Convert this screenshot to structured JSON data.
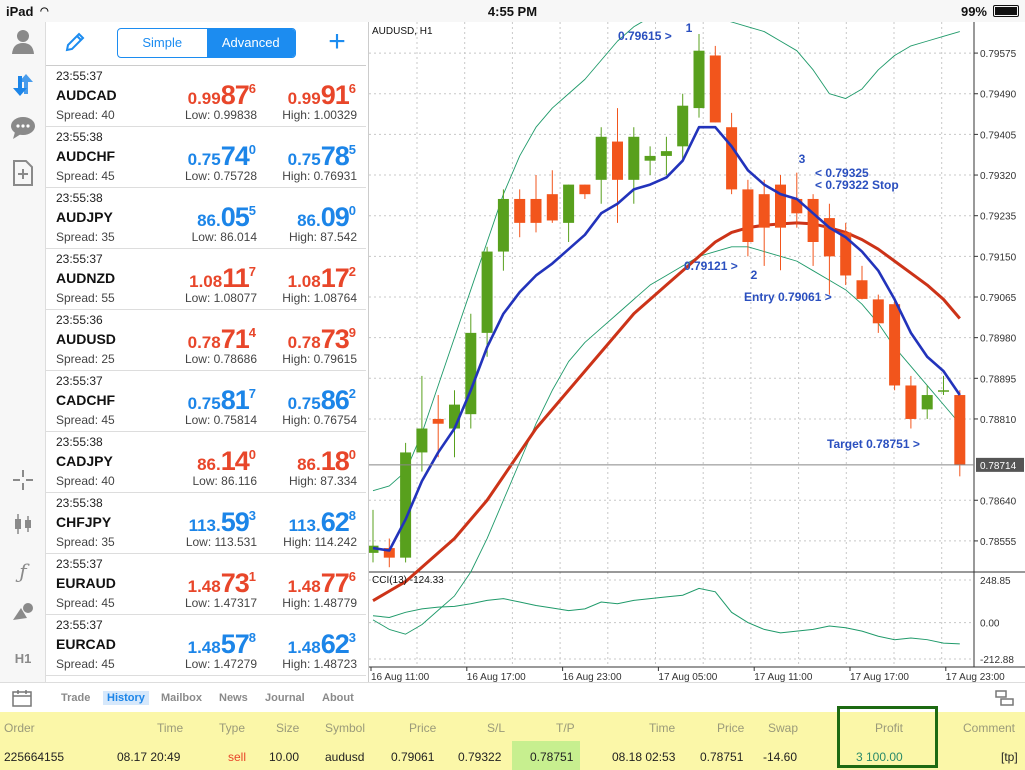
{
  "status": {
    "device": "iPad",
    "time": "4:55 PM",
    "battery": "99%"
  },
  "toolbar": {
    "simple_label": "Simple",
    "advanced_label": "Advanced"
  },
  "quotes": [
    {
      "time": "23:55:37",
      "symbol": "AUDCAD",
      "spread": "Spread: 40",
      "low": "Low: 0.99838",
      "high": "High: 1.00329",
      "bid": {
        "pre": "0.99",
        "big": "87",
        "sup": "6"
      },
      "ask": {
        "pre": "0.99",
        "big": "91",
        "sup": "6"
      },
      "color": "red"
    },
    {
      "time": "23:55:38",
      "symbol": "AUDCHF",
      "spread": "Spread: 45",
      "low": "Low: 0.75728",
      "high": "High: 0.76931",
      "bid": {
        "pre": "0.75",
        "big": "74",
        "sup": "0"
      },
      "ask": {
        "pre": "0.75",
        "big": "78",
        "sup": "5"
      },
      "color": "blue"
    },
    {
      "time": "23:55:38",
      "symbol": "AUDJPY",
      "spread": "Spread: 35",
      "low": "Low: 86.014",
      "high": "High: 87.542",
      "bid": {
        "pre": "86.",
        "big": "05",
        "sup": "5"
      },
      "ask": {
        "pre": "86.",
        "big": "09",
        "sup": "0"
      },
      "color": "blue"
    },
    {
      "time": "23:55:37",
      "symbol": "AUDNZD",
      "spread": "Spread: 55",
      "low": "Low: 1.08077",
      "high": "High: 1.08764",
      "bid": {
        "pre": "1.08",
        "big": "11",
        "sup": "7"
      },
      "ask": {
        "pre": "1.08",
        "big": "17",
        "sup": "2"
      },
      "color": "red"
    },
    {
      "time": "23:55:36",
      "symbol": "AUDUSD",
      "spread": "Spread: 25",
      "low": "Low: 0.78686",
      "high": "High: 0.79615",
      "bid": {
        "pre": "0.78",
        "big": "71",
        "sup": "4"
      },
      "ask": {
        "pre": "0.78",
        "big": "73",
        "sup": "9"
      },
      "color": "red"
    },
    {
      "time": "23:55:37",
      "symbol": "CADCHF",
      "spread": "Spread: 45",
      "low": "Low: 0.75814",
      "high": "High: 0.76754",
      "bid": {
        "pre": "0.75",
        "big": "81",
        "sup": "7"
      },
      "ask": {
        "pre": "0.75",
        "big": "86",
        "sup": "2"
      },
      "color": "blue"
    },
    {
      "time": "23:55:38",
      "symbol": "CADJPY",
      "spread": "Spread: 40",
      "low": "Low: 86.116",
      "high": "High: 87.334",
      "bid": {
        "pre": "86.",
        "big": "14",
        "sup": "0"
      },
      "ask": {
        "pre": "86.",
        "big": "18",
        "sup": "0"
      },
      "color": "red"
    },
    {
      "time": "23:55:38",
      "symbol": "CHFJPY",
      "spread": "Spread: 35",
      "low": "Low: 113.531",
      "high": "High: 114.242",
      "bid": {
        "pre": "113.",
        "big": "59",
        "sup": "3"
      },
      "ask": {
        "pre": "113.",
        "big": "62",
        "sup": "8"
      },
      "color": "blue"
    },
    {
      "time": "23:55:37",
      "symbol": "EURAUD",
      "spread": "Spread: 45",
      "low": "Low: 1.47317",
      "high": "High: 1.48779",
      "bid": {
        "pre": "1.48",
        "big": "73",
        "sup": "1"
      },
      "ask": {
        "pre": "1.48",
        "big": "77",
        "sup": "6"
      },
      "color": "red"
    },
    {
      "time": "23:55:37",
      "symbol": "EURCAD",
      "spread": "Spread: 45",
      "low": "Low: 1.47279",
      "high": "High: 1.48723",
      "bid": {
        "pre": "1.48",
        "big": "57",
        "sup": "8"
      },
      "ask": {
        "pre": "1.48",
        "big": "62",
        "sup": "3"
      },
      "color": "blue"
    }
  ],
  "left_icons": [
    "person-icon",
    "arrows-icon",
    "chat-icon",
    "new-doc-icon",
    "crosshair-icon",
    "candles-icon",
    "function-icon",
    "objects-icon",
    "timeframe-label"
  ],
  "timeframe_label": "H1",
  "chart": {
    "symbol_label": "AUDUSD, H1",
    "cci_label": "CCI(13) -124.33",
    "current_price": "0.78714",
    "price_axis": [
      "0.79575",
      "0.79490",
      "0.79405",
      "0.79320",
      "0.79235",
      "0.79150",
      "0.79065",
      "0.78980",
      "0.78895",
      "0.78810",
      "0.78640",
      "0.78555"
    ],
    "cci_axis": [
      "248.85",
      "0.00",
      "-212.88"
    ],
    "time_axis": [
      "16 Aug 11:00",
      "16 Aug 17:00",
      "16 Aug 23:00",
      "17 Aug 05:00",
      "17 Aug 11:00",
      "17 Aug 17:00",
      "17 Aug 23:00"
    ],
    "annotations": [
      "0.79615 >",
      "1",
      "3",
      "< 0.79325",
      "< 0.79322 Stop",
      "0.79121 >",
      "2",
      "Entry 0.79061 >",
      "Target 0.78751 >"
    ],
    "colors": {
      "up": "#58a01d",
      "down": "#f2551c",
      "fast_ma": "#2233bb",
      "slow_ma": "#cc3318",
      "bands": "#1f9a6a",
      "annot": "#2a4fbf"
    }
  },
  "chart_data": {
    "type": "candlestick",
    "ylim": [
      0.7849,
      0.7964
    ],
    "candles": [
      {
        "o": 0.7853,
        "h": 0.7862,
        "l": 0.7851,
        "c": 0.78545
      },
      {
        "o": 0.7854,
        "h": 0.7856,
        "l": 0.785,
        "c": 0.7852
      },
      {
        "o": 0.7852,
        "h": 0.7876,
        "l": 0.7851,
        "c": 0.7874
      },
      {
        "o": 0.7874,
        "h": 0.789,
        "l": 0.787,
        "c": 0.7879
      },
      {
        "o": 0.7881,
        "h": 0.7886,
        "l": 0.7873,
        "c": 0.788
      },
      {
        "o": 0.7879,
        "h": 0.7887,
        "l": 0.7873,
        "c": 0.7884
      },
      {
        "o": 0.7882,
        "h": 0.7903,
        "l": 0.7879,
        "c": 0.7899
      },
      {
        "o": 0.7899,
        "h": 0.7917,
        "l": 0.7894,
        "c": 0.7916
      },
      {
        "o": 0.7916,
        "h": 0.7929,
        "l": 0.7912,
        "c": 0.7927
      },
      {
        "o": 0.7927,
        "h": 0.7929,
        "l": 0.7919,
        "c": 0.7922
      },
      {
        "o": 0.7927,
        "h": 0.7932,
        "l": 0.792,
        "c": 0.7922
      },
      {
        "o": 0.7928,
        "h": 0.7933,
        "l": 0.7922,
        "c": 0.79225
      },
      {
        "o": 0.7922,
        "h": 0.793,
        "l": 0.7918,
        "c": 0.793
      },
      {
        "o": 0.793,
        "h": 0.793,
        "l": 0.7927,
        "c": 0.7928
      },
      {
        "o": 0.7931,
        "h": 0.7942,
        "l": 0.7926,
        "c": 0.794
      },
      {
        "o": 0.7939,
        "h": 0.7946,
        "l": 0.7922,
        "c": 0.7931
      },
      {
        "o": 0.7931,
        "h": 0.7942,
        "l": 0.7926,
        "c": 0.794
      },
      {
        "o": 0.7935,
        "h": 0.7938,
        "l": 0.7932,
        "c": 0.7936
      },
      {
        "o": 0.7936,
        "h": 0.794,
        "l": 0.7932,
        "c": 0.7937
      },
      {
        "o": 0.7938,
        "h": 0.7949,
        "l": 0.7935,
        "c": 0.79465
      },
      {
        "o": 0.7946,
        "h": 0.79615,
        "l": 0.7944,
        "c": 0.7958
      },
      {
        "o": 0.7957,
        "h": 0.7959,
        "l": 0.7943,
        "c": 0.7943
      },
      {
        "o": 0.7942,
        "h": 0.7945,
        "l": 0.7928,
        "c": 0.7929
      },
      {
        "o": 0.7929,
        "h": 0.7931,
        "l": 0.7915,
        "c": 0.7918
      },
      {
        "o": 0.7928,
        "h": 0.7931,
        "l": 0.7913,
        "c": 0.7921
      },
      {
        "o": 0.793,
        "h": 0.7932,
        "l": 0.79121,
        "c": 0.7921
      },
      {
        "o": 0.7927,
        "h": 0.79325,
        "l": 0.7921,
        "c": 0.7924
      },
      {
        "o": 0.7927,
        "h": 0.7928,
        "l": 0.7913,
        "c": 0.7918
      },
      {
        "o": 0.7923,
        "h": 0.7926,
        "l": 0.7907,
        "c": 0.7915
      },
      {
        "o": 0.792,
        "h": 0.7922,
        "l": 0.7909,
        "c": 0.7911
      },
      {
        "o": 0.791,
        "h": 0.7913,
        "l": 0.7906,
        "c": 0.79061
      },
      {
        "o": 0.7906,
        "h": 0.7907,
        "l": 0.7899,
        "c": 0.7901
      },
      {
        "o": 0.7905,
        "h": 0.7906,
        "l": 0.7887,
        "c": 0.7888
      },
      {
        "o": 0.7888,
        "h": 0.789,
        "l": 0.7879,
        "c": 0.7881
      },
      {
        "o": 0.7883,
        "h": 0.7888,
        "l": 0.7881,
        "c": 0.7886
      },
      {
        "o": 0.7887,
        "h": 0.789,
        "l": 0.7886,
        "c": 0.7887
      },
      {
        "o": 0.7886,
        "h": 0.7887,
        "l": 0.7869,
        "c": 0.78714
      }
    ],
    "fast_ma": [
      0.7854,
      0.78535,
      0.786,
      0.7868,
      0.7874,
      0.7879,
      0.7887,
      0.7896,
      0.7903,
      0.79075,
      0.7911,
      0.79135,
      0.79165,
      0.79195,
      0.7924,
      0.7926,
      0.7929,
      0.793,
      0.79315,
      0.7935,
      0.7942,
      0.7942,
      0.7938,
      0.7933,
      0.793,
      0.7928,
      0.7927,
      0.7924,
      0.7921,
      0.7919,
      0.7916,
      0.7912,
      0.7906,
      0.7899,
      0.7894,
      0.7891,
      0.7886
    ],
    "slow_ma": [
      0.7843,
      0.7845,
      0.7847,
      0.785,
      0.7853,
      0.7856,
      0.786,
      0.7864,
      0.7869,
      0.7874,
      0.7879,
      0.7883,
      0.7887,
      0.7891,
      0.7895,
      0.7899,
      0.7903,
      0.7906,
      0.7909,
      0.7912,
      0.7915,
      0.7918,
      0.792,
      0.7921,
      0.79215,
      0.79218,
      0.7922,
      0.79218,
      0.7921,
      0.792,
      0.79185,
      0.79165,
      0.7914,
      0.79115,
      0.7909,
      0.7906,
      0.7902
    ],
    "upper_band": [
      0.7866,
      0.7867,
      0.787,
      0.7878,
      0.7888,
      0.7898,
      0.7908,
      0.7918,
      0.7928,
      0.7936,
      0.7942,
      0.7946,
      0.7949,
      0.7952,
      0.7956,
      0.796,
      0.7963,
      0.7965,
      0.7965,
      0.7965,
      0.7965,
      0.7965,
      0.7964,
      0.7963,
      0.7962,
      0.796,
      0.7958,
      0.7954,
      0.7949,
      0.7948,
      0.795,
      0.7954,
      0.7957,
      0.7959,
      0.796,
      0.7961,
      0.7962
    ],
    "lower_band": [
      0.7839,
      0.7837,
      0.7836,
      0.7838,
      0.7841,
      0.7844,
      0.7849,
      0.7856,
      0.7864,
      0.7872,
      0.788,
      0.7887,
      0.7893,
      0.7897,
      0.79,
      0.7903,
      0.7906,
      0.7909,
      0.7911,
      0.7913,
      0.7915,
      0.7916,
      0.7917,
      0.7917,
      0.7916,
      0.7915,
      0.7914,
      0.7912,
      0.791,
      0.7908,
      0.7905,
      0.7901,
      0.7896,
      0.7892,
      0.7888,
      0.7884,
      0.788
    ],
    "cci": [
      40,
      30,
      60,
      80,
      90,
      95,
      110,
      130,
      140,
      120,
      100,
      85,
      70,
      80,
      120,
      110,
      130,
      140,
      150,
      160,
      200,
      180,
      60,
      0,
      -40,
      -60,
      -50,
      -40,
      -20,
      -30,
      -50,
      -80,
      -100,
      -90,
      -100,
      -120,
      -124.33
    ],
    "cci_ylim": [
      -212.88,
      248.85
    ]
  },
  "bottom_tabs": [
    "Trade",
    "History",
    "Mailbox",
    "News",
    "Journal",
    "About"
  ],
  "active_tab": "History",
  "table": {
    "headers": [
      "Order",
      "Time",
      "Type",
      "Size",
      "Symbol",
      "Price",
      "S/L",
      "T/P",
      "Time",
      "Price",
      "Swap",
      "Profit",
      "Comment"
    ],
    "row": [
      "225664155",
      "08.17 20:49",
      "sell",
      "10.00",
      "audusd",
      "0.79061",
      "0.79322",
      "0.78751",
      "08.18 02:53",
      "0.78751",
      "-14.60",
      "3 100.00",
      "[tp]"
    ]
  }
}
